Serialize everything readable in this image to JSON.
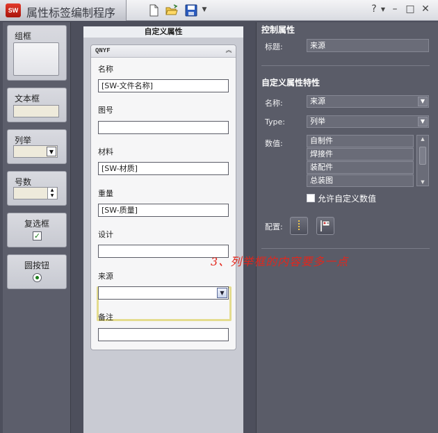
{
  "window": {
    "title": "属性标签编制程序",
    "logo_text": "SW",
    "help_label": "?",
    "controls": [
      "–",
      "□",
      "✕"
    ]
  },
  "toolbar": {
    "icons": [
      "new-document-icon",
      "open-folder-icon",
      "save-icon"
    ]
  },
  "toolbox": {
    "group_box": "组框",
    "text_box": "文本框",
    "list": "列举",
    "number": "号数",
    "checkbox": "复选框",
    "radio_button": "圆按钮"
  },
  "form": {
    "header": "自定义属性",
    "group_title": "QNYF",
    "fields": {
      "name": {
        "label": "名称",
        "value": "[SW-文件名称]"
      },
      "drawing_no": {
        "label": "图号",
        "value": ""
      },
      "material": {
        "label": "材料",
        "value": "[SW-材质]"
      },
      "weight": {
        "label": "重量",
        "value": "[SW-质量]"
      },
      "design": {
        "label": "设计",
        "value": ""
      },
      "source": {
        "label": "来源",
        "value": ""
      },
      "remark": {
        "label": "备注",
        "value": ""
      }
    }
  },
  "properties": {
    "control_title": "控制属性",
    "caption_label": "标题:",
    "caption_value": "来源",
    "custom_title": "自定义属性特性",
    "name_label": "名称:",
    "name_value": "来源",
    "type_label": "Type:",
    "type_value": "列举",
    "values_label": "数值:",
    "values": [
      "自制件",
      "焊接件",
      "装配件",
      "总装图"
    ],
    "allow_custom_label": "允许自定义数值",
    "config_label": "配置:"
  },
  "annotation": {
    "text": "3、列举框的内容要多一点",
    "color": "#e3261c"
  }
}
